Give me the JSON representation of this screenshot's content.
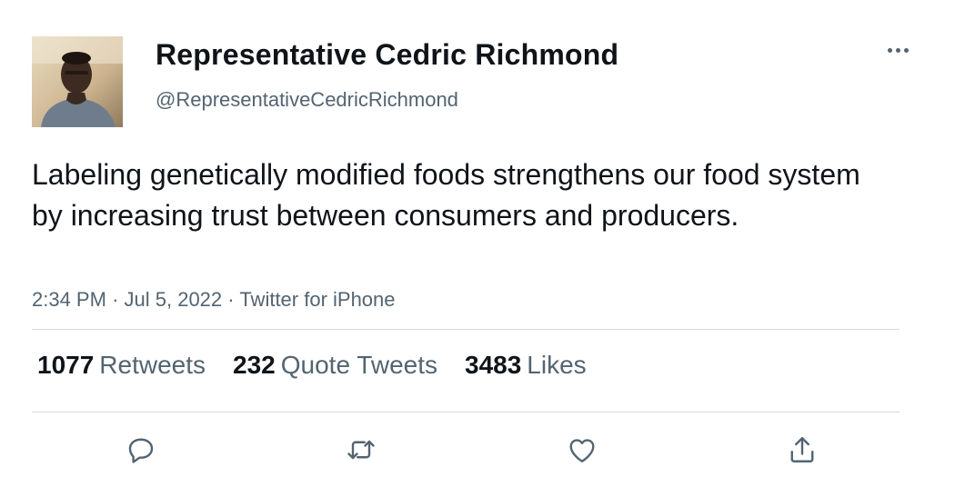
{
  "user": {
    "name": "Representative Cedric Richmond",
    "handle": "@RepresentativeCedricRichmond"
  },
  "tweet": {
    "text": "Labeling genetically modified foods strengthens our food system by increasing trust between consumers and producers.",
    "time": "2:34 PM",
    "date": "Jul 5, 2022",
    "source": "Twitter for iPhone",
    "separator": "·"
  },
  "stats": {
    "retweets": {
      "count": "1077",
      "label": "Retweets"
    },
    "quotes": {
      "count": "232",
      "label": "Quote Tweets"
    },
    "likes": {
      "count": "3483",
      "label": "Likes"
    }
  },
  "icons": {
    "more": "more-horizontal-icon",
    "reply": "reply-icon",
    "retweet": "retweet-icon",
    "like": "heart-icon",
    "share": "share-icon"
  },
  "colors": {
    "text": "#0f1419",
    "secondary": "#536471",
    "divider": "#cfd9de"
  }
}
